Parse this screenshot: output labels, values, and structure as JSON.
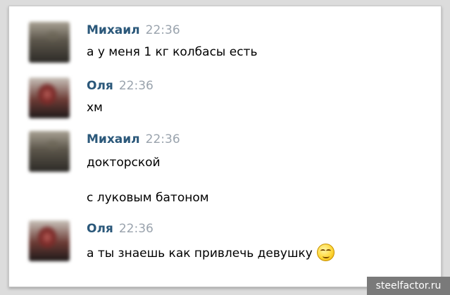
{
  "messages": [
    {
      "author": "Михаил",
      "time": "22:36",
      "avatar": "avatar-mikhail",
      "lines": [
        "а у меня 1 кг колбасы есть"
      ]
    },
    {
      "author": "Оля",
      "time": "22:36",
      "avatar": "avatar-olya",
      "lines": [
        "хм"
      ]
    },
    {
      "author": "Михаил",
      "time": "22:36",
      "avatar": "avatar-mikhail",
      "lines": [
        "докторской",
        "с луковым батоном"
      ]
    },
    {
      "author": "Оля",
      "time": "22:36",
      "avatar": "avatar-olya",
      "lines": [
        "а ты знаешь как привлечь девушку"
      ],
      "emoji": "smirk-emoji-icon"
    }
  ],
  "watermark": "steelfactor.ru",
  "colors": {
    "author_name": "#2b587a",
    "timestamp": "#9aa3ad",
    "text": "#000000",
    "background": "#ffffff"
  }
}
